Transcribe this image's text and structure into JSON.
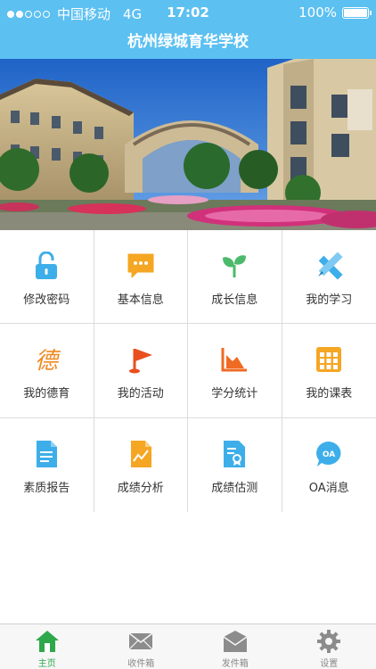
{
  "status_bar": {
    "carrier": "中国移动",
    "network": "4G",
    "time": "17:02",
    "battery": "100%"
  },
  "header": {
    "title": "杭州绿城育华学校"
  },
  "menu": [
    {
      "label": "修改密码",
      "icon": "lock-icon",
      "color": "#3daee9"
    },
    {
      "label": "基本信息",
      "icon": "chat-icon",
      "color": "#f5a623"
    },
    {
      "label": "成长信息",
      "icon": "sprout-icon",
      "color": "#4cba6b"
    },
    {
      "label": "我的学习",
      "icon": "ruler-pencil-icon",
      "color": "#3daee9"
    },
    {
      "label": "我的德育",
      "icon": "de-character-icon",
      "color": "#ef8a22"
    },
    {
      "label": "我的活动",
      "icon": "flag-icon",
      "color": "#e94f1d"
    },
    {
      "label": "学分统计",
      "icon": "area-chart-icon",
      "color": "#ef6a22"
    },
    {
      "label": "我的课表",
      "icon": "calendar-grid-icon",
      "color": "#f5a623"
    },
    {
      "label": "素质报告",
      "icon": "document-icon",
      "color": "#3daee9"
    },
    {
      "label": "成绩分析",
      "icon": "trend-document-icon",
      "color": "#f5a623"
    },
    {
      "label": "成绩估测",
      "icon": "certificate-icon",
      "color": "#3daee9"
    },
    {
      "label": "OA消息",
      "icon": "oa-bubble-icon",
      "color": "#3daee9"
    }
  ],
  "tabbar": [
    {
      "label": "主页",
      "icon": "home-icon",
      "active": true
    },
    {
      "label": "收件箱",
      "icon": "mail-icon",
      "active": false
    },
    {
      "label": "发件箱",
      "icon": "outbox-icon",
      "active": false
    },
    {
      "label": "设置",
      "icon": "gear-icon",
      "active": false
    }
  ],
  "colors": {
    "header": "#5cc0f1",
    "tab_active": "#2ea84b",
    "tab_inactive": "#8c8c8c"
  }
}
